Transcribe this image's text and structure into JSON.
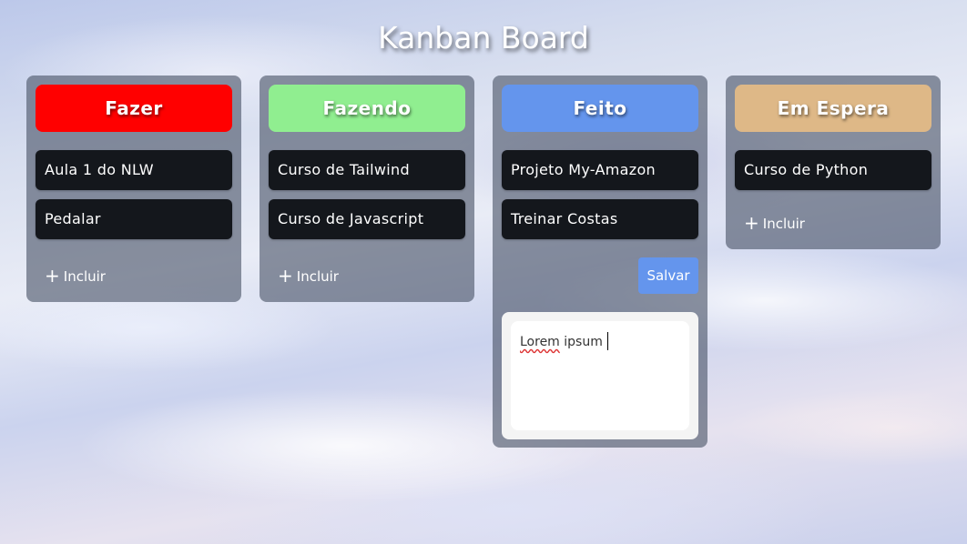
{
  "board": {
    "title": "Kanban Board"
  },
  "columns": [
    {
      "title": "Fazer",
      "color": "#ff0000",
      "cards": [
        "Aula 1 do NLW",
        "Pedalar"
      ],
      "add_label": "Incluir"
    },
    {
      "title": "Fazendo",
      "color": "#90ee90",
      "cards": [
        "Curso de Tailwind",
        "Curso de Javascript"
      ],
      "add_label": "Incluir"
    },
    {
      "title": "Feito",
      "color": "#6495ed",
      "cards": [
        "Projeto My-Amazon",
        "Treinar Costas"
      ],
      "save_label": "Salvar",
      "editor": {
        "word1": "Lorem",
        "word2": "ipsum"
      }
    },
    {
      "title": "Em Espera",
      "color": "#deb887",
      "cards": [
        "Curso de Python"
      ],
      "add_label": "Incluir"
    }
  ],
  "icons": {
    "add": "plus-icon"
  }
}
